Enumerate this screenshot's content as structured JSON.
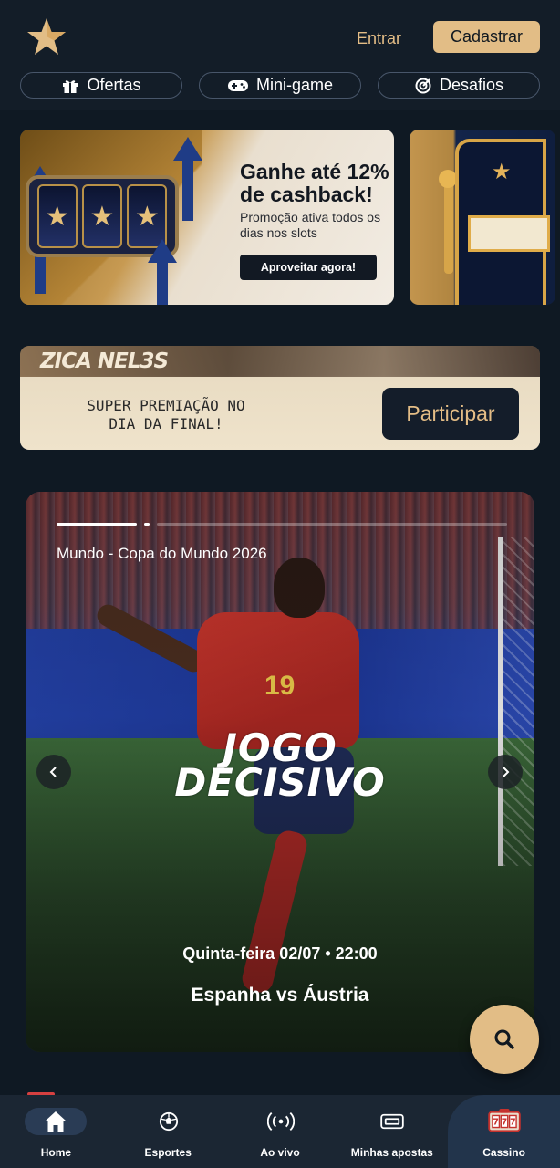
{
  "header": {
    "login_label": "Entrar",
    "signup_label": "Cadastrar",
    "pills": [
      {
        "label": "Ofertas",
        "icon": "gift-icon"
      },
      {
        "label": "Mini-game",
        "icon": "gamepad-icon"
      },
      {
        "label": "Desafios",
        "icon": "target-icon"
      }
    ]
  },
  "promo": {
    "title": "Ganhe até 12% de cashback!",
    "subtitle": "Promoção ativa todos os dias nos slots",
    "button": "Aproveitar agora!"
  },
  "zica": {
    "logo": "ZICA NEL3S",
    "text": "SUPER PREMIAÇÃO NO DIA DA FINAL!",
    "button": "Participar"
  },
  "match": {
    "competition": "Mundo - Copa do Mundo 2026",
    "headline_line1": "JOGO",
    "headline_line2": "DECISIVO",
    "datetime": "Quinta-feira 02/07 • 22:00",
    "teams": "Espanha vs Áustria",
    "player_number": "19"
  },
  "bottom_nav": [
    {
      "label": "Home",
      "icon": "home-icon"
    },
    {
      "label": "Esportes",
      "icon": "soccer-ball-icon"
    },
    {
      "label": "Ao vivo",
      "icon": "live-broadcast-icon"
    },
    {
      "label": "Minhas apostas",
      "icon": "ticket-icon"
    },
    {
      "label": "Cassino",
      "icon": "slot-machine-icon"
    }
  ],
  "colors": {
    "background": "#0f1923",
    "accent_gold": "#e2bd86",
    "nav_bg": "#1b2633"
  }
}
